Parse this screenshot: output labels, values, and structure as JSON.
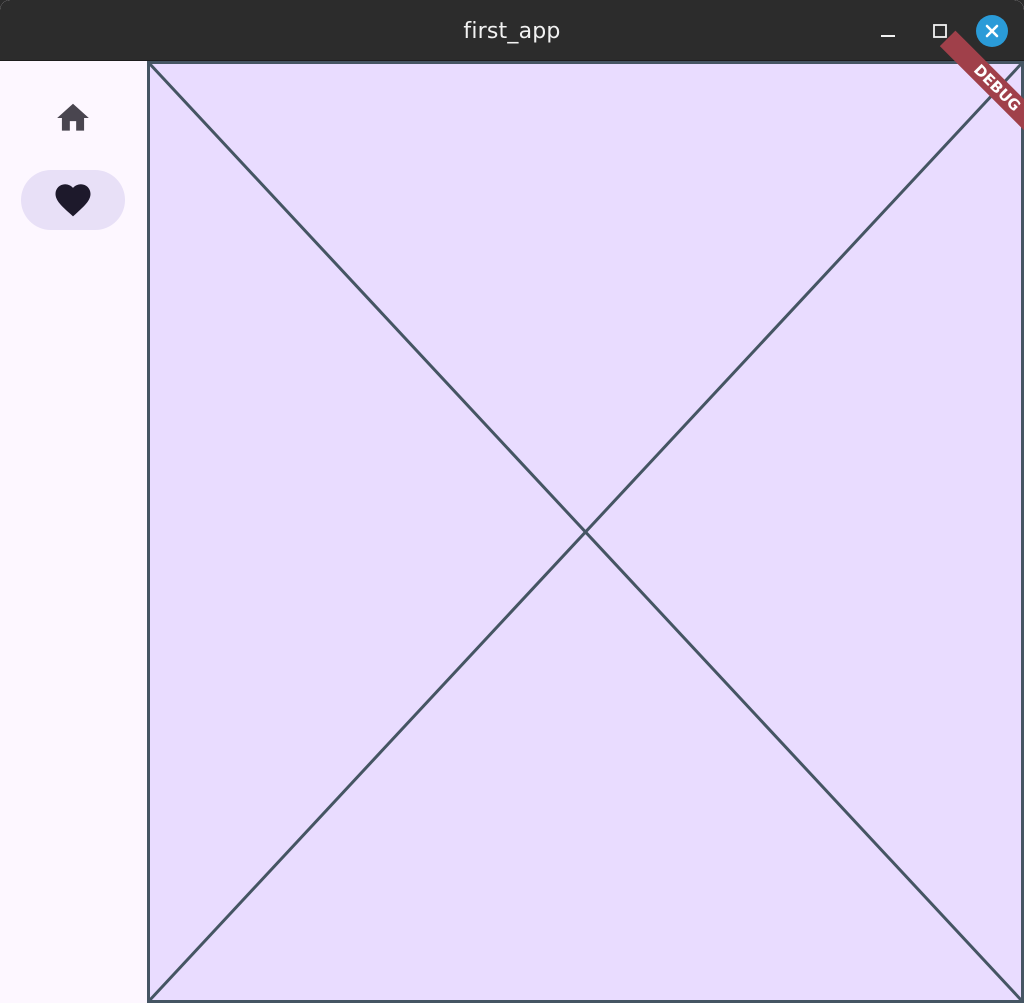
{
  "window": {
    "title": "first_app",
    "controls": {
      "minimize_icon": "minimize-icon",
      "maximize_icon": "maximize-icon",
      "close_icon": "close-icon"
    }
  },
  "navigation_rail": {
    "items": [
      {
        "icon": "home-icon",
        "selected": false
      },
      {
        "icon": "favorite-heart-icon",
        "selected": true
      }
    ]
  },
  "content": {
    "placeholder_icon": "placeholder-cross-icon"
  },
  "debug_banner": {
    "label": "DEBUG"
  },
  "colors": {
    "titlebar": "#2c2c2c",
    "rail_background": "#fdf7ff",
    "rail_indicator": "#e8e0f7",
    "content_background": "#e9dcff",
    "placeholder_stroke": "#455563",
    "close_button": "#2a9bd8",
    "debug_banner": "#a0404a"
  }
}
